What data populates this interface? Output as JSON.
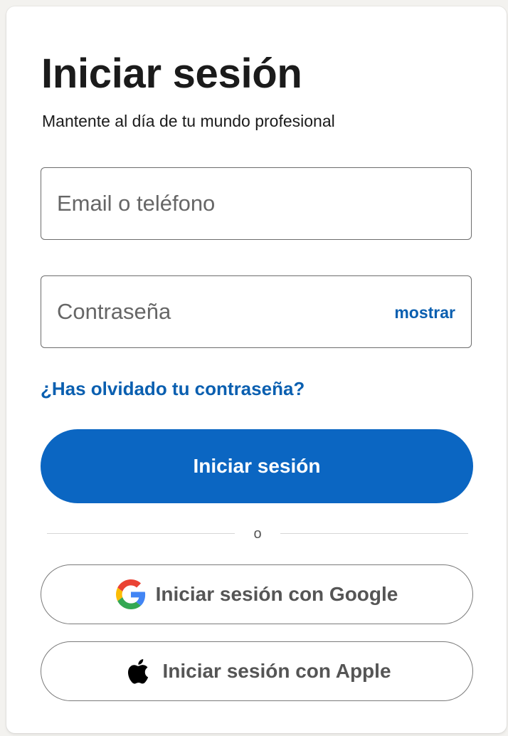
{
  "header": {
    "title": "Iniciar sesión",
    "subtitle": "Mantente al día de tu mundo profesional"
  },
  "form": {
    "email_placeholder": "Email o teléfono",
    "email_value": "",
    "password_placeholder": "Contraseña",
    "password_value": "",
    "show_label": "mostrar",
    "forgot_link": "¿Has olvidado tu contraseña?",
    "submit_label": "Iniciar sesión"
  },
  "divider": {
    "text": "o"
  },
  "social": {
    "google_label": "Iniciar sesión con Google",
    "google_icon": "google-logo-icon",
    "apple_label": "Iniciar sesión con Apple",
    "apple_icon": "apple-logo-icon"
  },
  "colors": {
    "primary": "#0b66c2",
    "link": "#0a5fb0",
    "text": "#1b1b1b"
  }
}
